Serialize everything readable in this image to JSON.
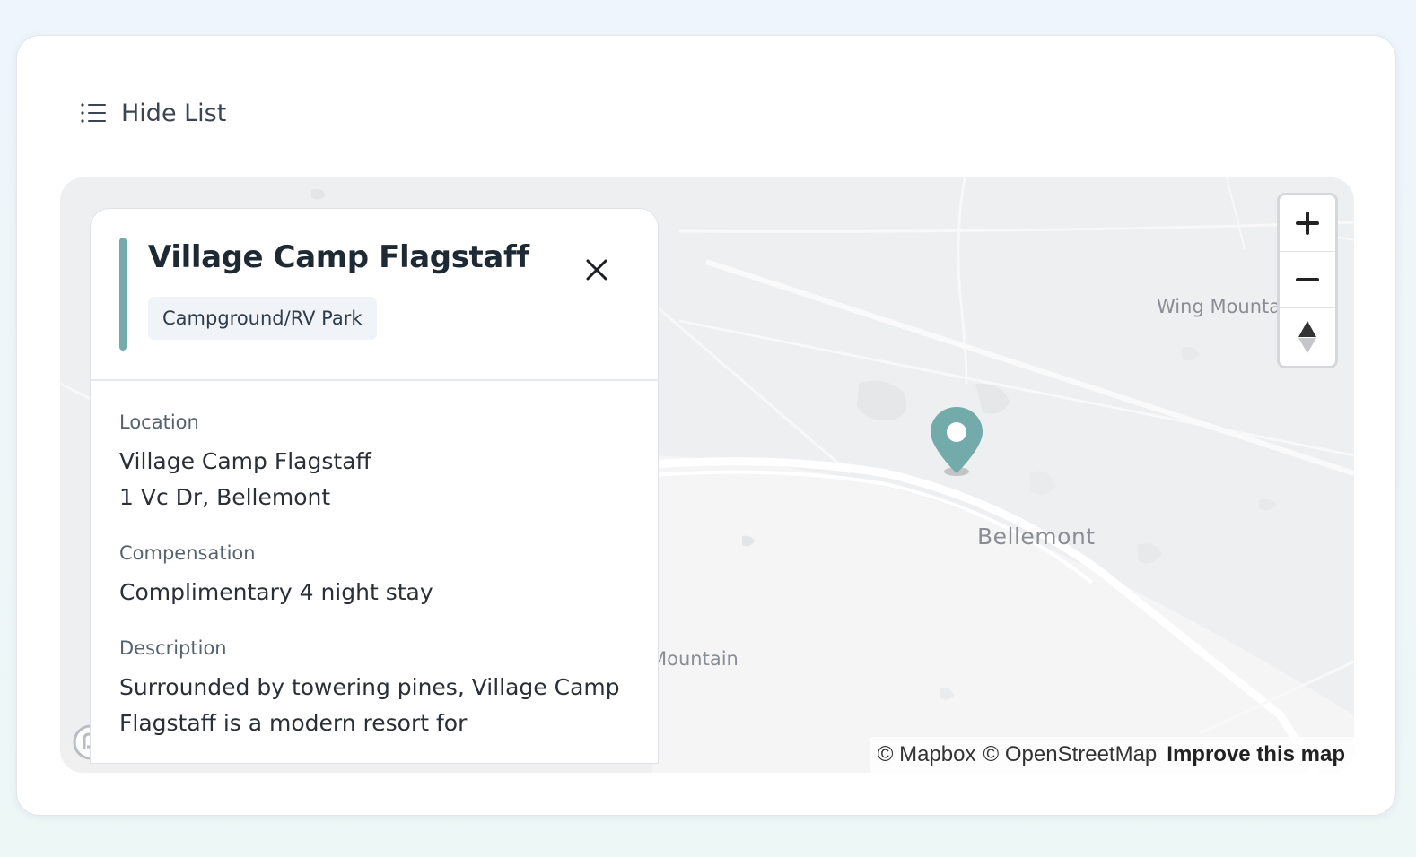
{
  "toolbar": {
    "hide_list_label": "Hide List"
  },
  "map": {
    "labels": {
      "wing": "Wing Mountai",
      "bellemont": "Bellemont",
      "mountain": "Mountain"
    },
    "controls": {
      "zoom_in": "+",
      "zoom_out": "−"
    },
    "attribution": {
      "mapbox": "© Mapbox",
      "osm": "© OpenStreetMap",
      "improve": "Improve this map"
    },
    "logo_text": "mapbox",
    "marker_color": "#73abaa"
  },
  "panel": {
    "title": "Village Camp Flagstaff",
    "type": "Campground/RV Park",
    "accent_color": "#73abaa",
    "location": {
      "label": "Location",
      "name": "Village Camp Flagstaff",
      "address": "1 Vc Dr, Bellemont"
    },
    "compensation": {
      "label": "Compensation",
      "value": "Complimentary 4 night stay"
    },
    "description": {
      "label": "Description",
      "value": "Surrounded by towering pines, Village Camp Flagstaff is a modern resort for"
    }
  }
}
